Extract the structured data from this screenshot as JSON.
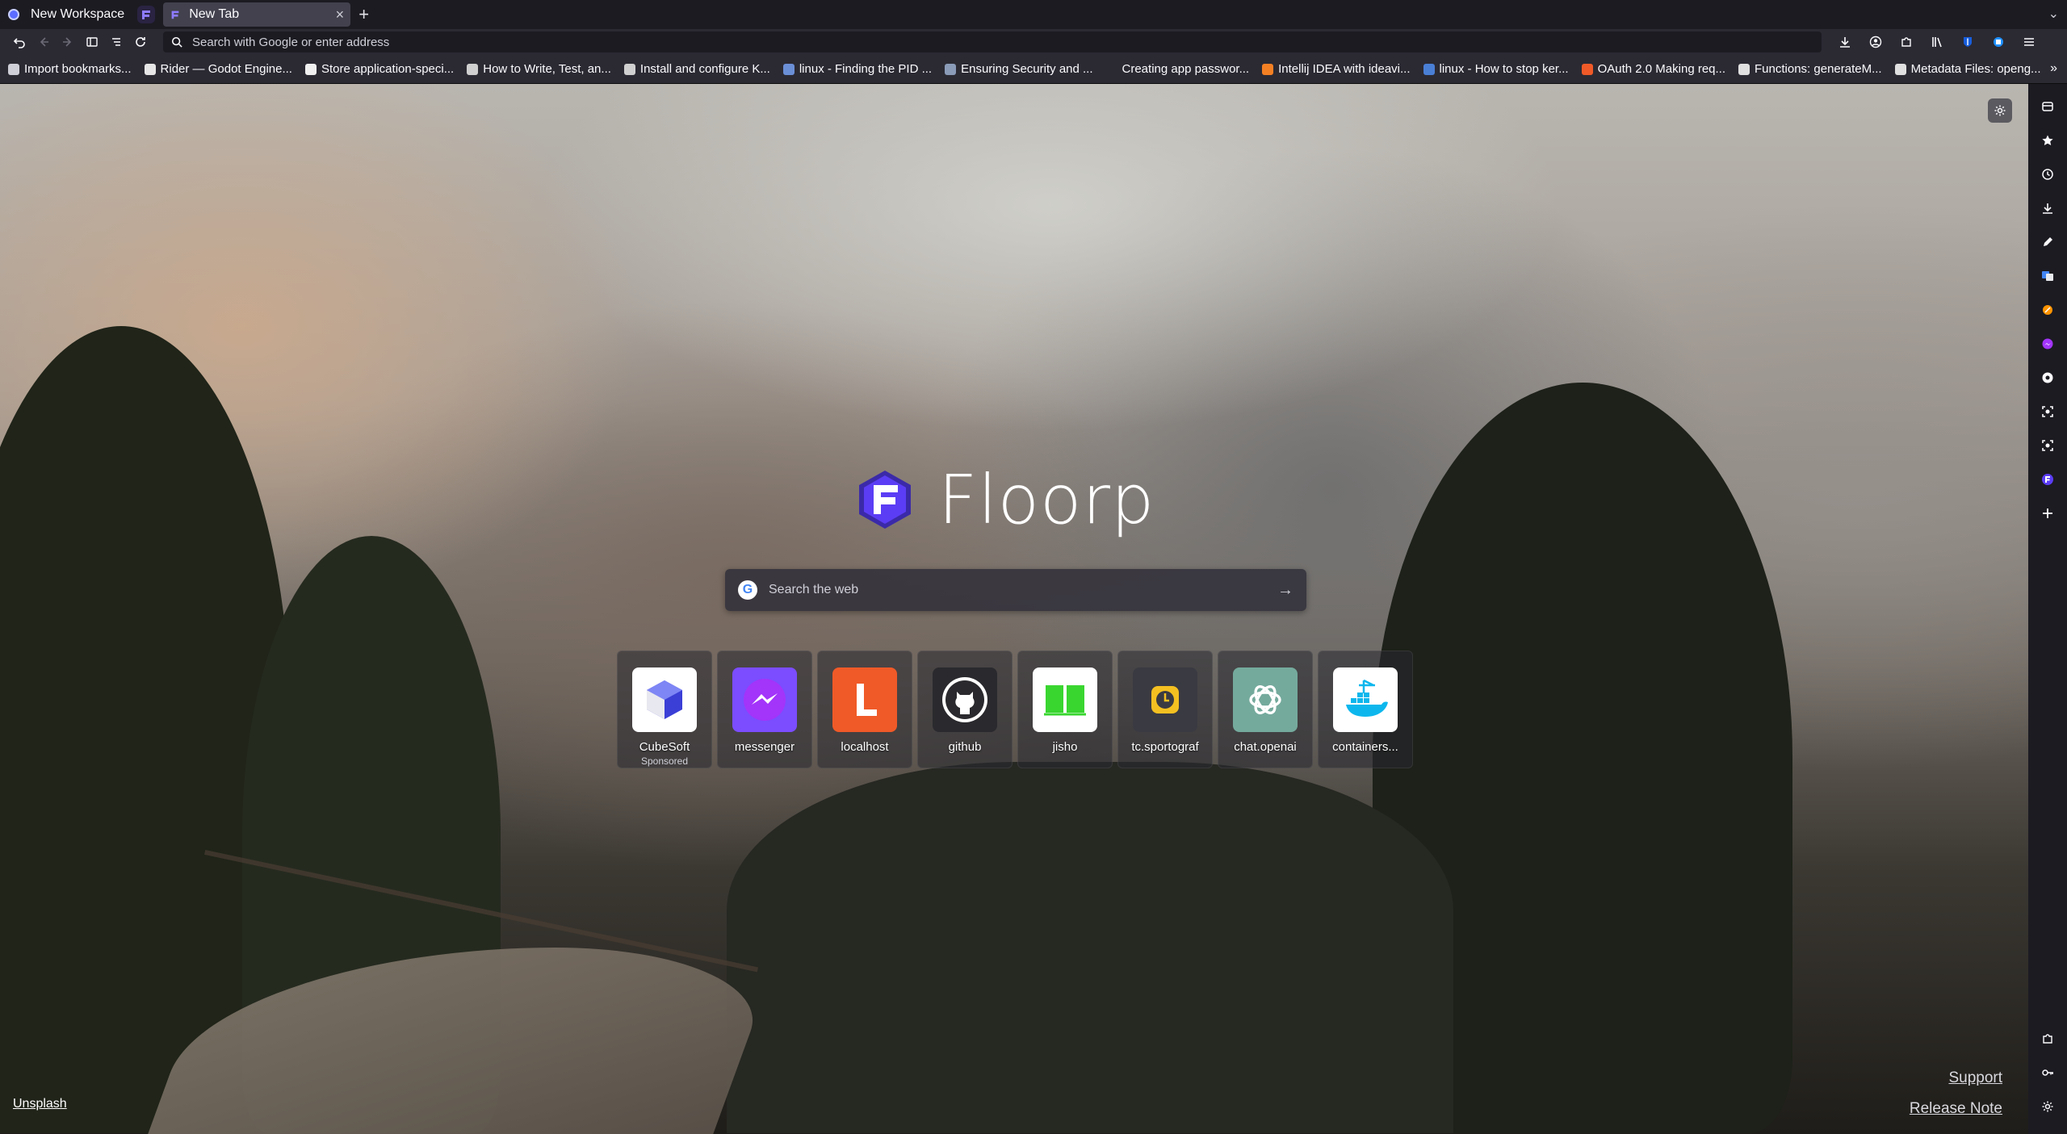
{
  "tabstrip": {
    "workspace_label": "New Workspace",
    "active_tab_label": "New Tab",
    "close_glyph": "×",
    "new_tab_glyph": "+",
    "overflow_glyph": "⌄"
  },
  "navbar": {
    "url_placeholder": "Search with Google or enter address"
  },
  "bookmarks": [
    {
      "label": "Import bookmarks...",
      "icon": "import-icon",
      "color": "#cfcfd8"
    },
    {
      "label": "Rider — Godot Engine...",
      "icon": "rider-icon",
      "color": "#e6e6e6"
    },
    {
      "label": "Store application-speci...",
      "icon": "chrome-icon",
      "color": "#f0f0f0"
    },
    {
      "label": "How to Write, Test, an...",
      "icon": "code-icon",
      "color": "#d0d0d0"
    },
    {
      "label": "Install and configure K...",
      "icon": "globe-icon",
      "color": "#d0d0d0"
    },
    {
      "label": "linux - Finding the PID ...",
      "icon": "stackexchange-icon",
      "color": "#6b8fd6"
    },
    {
      "label": "Ensuring Security and ...",
      "icon": "gear-icon",
      "color": "#8a9bb8"
    },
    {
      "label": "Creating app passwor...",
      "icon": "blank-icon",
      "color": "#2b2a33"
    },
    {
      "label": "Intellij IDEA with ideavi...",
      "icon": "stackoverflow-icon",
      "color": "#f48024"
    },
    {
      "label": "linux - How to stop ker...",
      "icon": "stackexchange-icon",
      "color": "#4a7fd6"
    },
    {
      "label": "OAuth 2.0 Making req...",
      "icon": "x-icon",
      "color": "#f05a28"
    },
    {
      "label": "Functions: generateM...",
      "icon": "n-icon",
      "color": "#e0e0e0"
    },
    {
      "label": "Metadata Files: openg...",
      "icon": "n-icon",
      "color": "#e0e0e0"
    }
  ],
  "brand": {
    "name": "Floorp",
    "accent": "#5b3df5"
  },
  "search": {
    "placeholder": "Search the web",
    "go_glyph": "→",
    "engine_glyph": "G"
  },
  "tiles": [
    {
      "label": "CubeSoft",
      "sub": "Sponsored",
      "icon": "cube-icon",
      "bg": "#ffffff"
    },
    {
      "label": "messenger",
      "sub": "",
      "icon": "messenger-icon",
      "bg": "#7b4dff"
    },
    {
      "label": "localhost",
      "sub": "",
      "icon": "localhost-icon",
      "bg": "#f05a28"
    },
    {
      "label": "github",
      "sub": "",
      "icon": "github-icon",
      "bg": "#2a2a2e"
    },
    {
      "label": "jisho",
      "sub": "",
      "icon": "book-icon",
      "bg": "#ffffff"
    },
    {
      "label": "tc.sportograf",
      "sub": "",
      "icon": "clock-icon",
      "bg": "#3a3a42"
    },
    {
      "label": "chat.openai",
      "sub": "",
      "icon": "openai-icon",
      "bg": "#74aa9c"
    },
    {
      "label": "containers...",
      "sub": "",
      "icon": "docker-icon",
      "bg": "#ffffff"
    }
  ],
  "footer": {
    "unsplash": "Unsplash",
    "support": "Support",
    "release_note": "Release Note"
  },
  "sidebar": {
    "items": [
      "bookmarks-panel-icon",
      "star-icon",
      "history-icon",
      "download-icon",
      "pen-icon",
      "translate-icon",
      "orange-icon",
      "messenger-icon",
      "chrome-icon",
      "screenshot-icon",
      "screenshot-icon",
      "floorp-icon",
      "add-icon"
    ],
    "bottom": [
      "extension-icon",
      "key-icon",
      "settings-icon"
    ]
  }
}
